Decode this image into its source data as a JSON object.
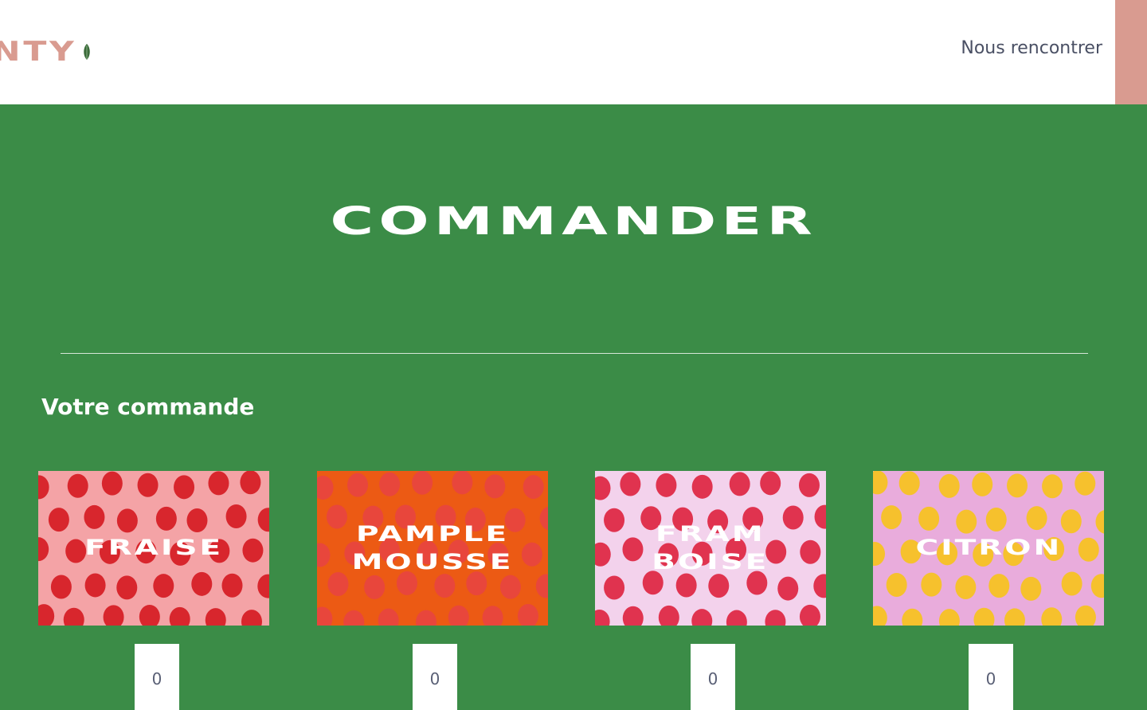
{
  "header": {
    "logo_text": "NTY",
    "nav_label": "Nous rencontrer"
  },
  "hero": {
    "title": "COMMANDER"
  },
  "order": {
    "title": "Votre commande",
    "products": [
      {
        "name": "FRAISE",
        "quantity": "0",
        "bg": "#f4a3a6",
        "fruit": "#d8262d"
      },
      {
        "name": "PAMPLE\nMOUSSE",
        "quantity": "0",
        "bg": "#ec5a14",
        "fruit": "#e8463c"
      },
      {
        "name": "FRAM\nBOISE",
        "quantity": "0",
        "bg": "#f3d2ec",
        "fruit": "#e0334f"
      },
      {
        "name": "CITRON",
        "quantity": "0",
        "bg": "#e9acdc",
        "fruit": "#f6c12d"
      }
    ]
  },
  "colors": {
    "accent_green": "#3b8c47",
    "accent_pink": "#d99b90",
    "nav_text": "#4a5064"
  }
}
